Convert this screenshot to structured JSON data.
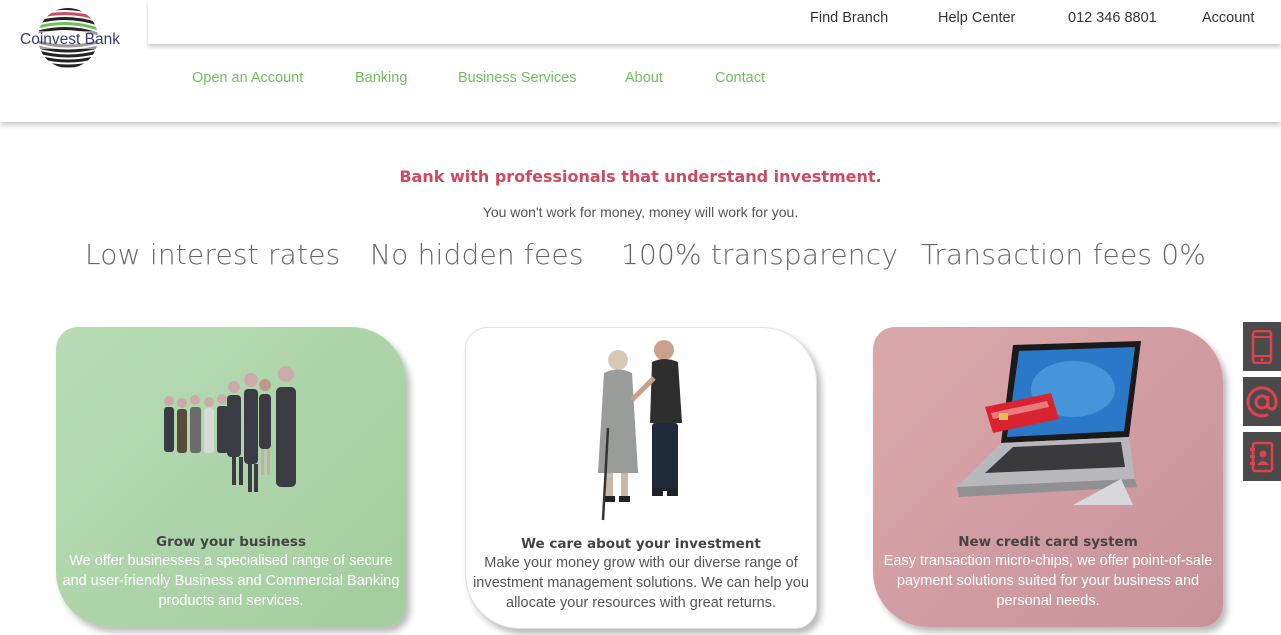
{
  "brand": {
    "name": "Coinvest Bank"
  },
  "top_links": [
    "Find Branch",
    "Help Center",
    "012 346 8801",
    "Account"
  ],
  "nav": [
    "Open an Account",
    "Banking",
    "Business Services",
    "About",
    "Contact"
  ],
  "intro": {
    "headline": "Bank with professionals that understand investment.",
    "subline": "You won't work for money, money will work for you."
  },
  "features": [
    "Low interest rates",
    "No hidden fees",
    "100% transparency",
    "Transaction fees 0%"
  ],
  "cards": [
    {
      "title": "Grow your business",
      "text": "We offer businesses a specialised range of secure and user-friendly Business and Commercial Banking products and services.",
      "image": "business-group-handshake"
    },
    {
      "title": "We care about your investment",
      "text": "Make your money grow with our diverse range of investment management solutions. We can help you allocate your resources with great returns.",
      "image": "caregiver-with-elderly-woman"
    },
    {
      "title": "New credit card system",
      "text": "Easy transaction micro-chips, we offer point-of-sale payment solutions suited for your business and personal needs.",
      "image": "laptop-with-credit-card"
    }
  ],
  "side_tabs": [
    "mobile-phone-icon",
    "at-sign-icon",
    "contact-book-icon"
  ],
  "colors": {
    "nav_green": "#6fc05a",
    "headline_red": "#cf4a60",
    "side_tab_bg": "#4a4a4a",
    "side_icon_red": "#e0414d",
    "card_green": "#a3cd9e",
    "card_rose": "#c79298"
  }
}
